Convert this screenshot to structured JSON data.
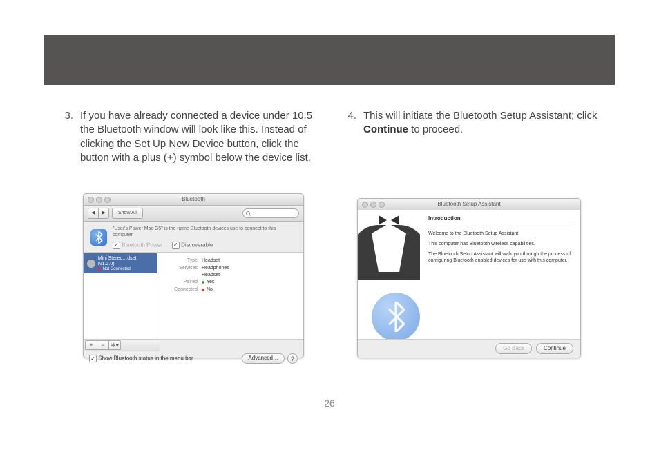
{
  "page_number": "26",
  "steps": {
    "three": {
      "num": "3.",
      "text_a": "If you have already connected a device under 10.5 the Bluetooth window will look like this. Instead of clicking the Set Up New Device button, click the button with a plus (+) symbol below the device list."
    },
    "four": {
      "num": "4.",
      "text_a": "This will initiate the Bluetooth Setup Assistant; click ",
      "bold": "Continue",
      "text_b": " to proceed."
    }
  },
  "bt_prefs": {
    "title": "Bluetooth",
    "back_icon": "◀",
    "fwd_icon": "▶",
    "show_all": "Show All",
    "search_placeholder": "",
    "info_line": "\"User's Power Mac G5\" is the name Bluetooth devices use to connect to this computer",
    "power_label": "Bluetooth Power",
    "discoverable_label": "Discoverable",
    "device": {
      "name": "Mini Stereo…dset (v1.2.0)",
      "status": "Not Connected"
    },
    "details": {
      "type_k": "Type",
      "type_v": "Headset",
      "services_k": "Services",
      "services_v1": "Headphones",
      "services_v2": "Headset",
      "paired_k": "Paired",
      "paired_v": "Yes",
      "connected_k": "Connected",
      "connected_v": "No"
    },
    "plus": "+",
    "minus": "−",
    "gear": "✻▾",
    "show_status": "Show Bluetooth status in the menu bar",
    "advanced": "Advanced…",
    "help": "?"
  },
  "assistant": {
    "title": "Bluetooth Setup Assistant",
    "heading": "Introduction",
    "p1": "Welcome to the Bluetooth Setup Assistant.",
    "p2": "This computer has Bluetooth wireless capabilities.",
    "p3": "The Bluetooth Setup Assistant will walk you through the process of configuring Bluetooth enabled devices for use with this computer.",
    "go_back": "Go Back",
    "continue": "Continue"
  }
}
